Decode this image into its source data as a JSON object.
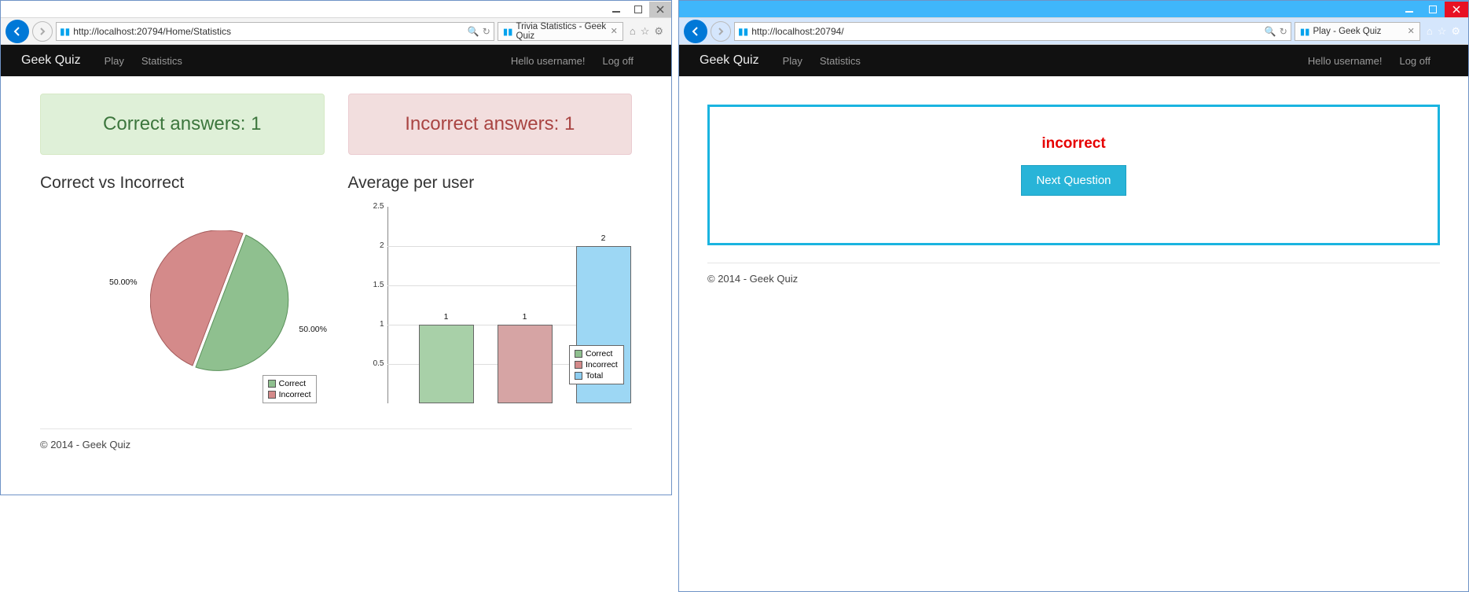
{
  "windows": {
    "left": {
      "address_url": "http://localhost:20794/Home/Statistics",
      "tab_title": "Trivia Statistics - Geek Quiz"
    },
    "right": {
      "address_url": "http://localhost:20794/",
      "tab_title": "Play - Geek Quiz"
    }
  },
  "navbar": {
    "brand": "Geek Quiz",
    "links": {
      "play": "Play",
      "statistics": "Statistics"
    },
    "greeting": "Hello username!",
    "logoff": "Log off"
  },
  "stats": {
    "correct_alert": "Correct answers: 1",
    "incorrect_alert": "Incorrect answers: 1",
    "pie_heading": "Correct vs Incorrect",
    "bar_heading": "Average per user",
    "legend": {
      "correct": "Correct",
      "incorrect": "Incorrect",
      "total": "Total"
    },
    "pie_labels": {
      "correct_pct": "50.00%",
      "incorrect_pct": "50.00%"
    }
  },
  "chart_data": [
    {
      "type": "pie",
      "title": "Correct vs Incorrect",
      "series": [
        {
          "name": "Correct",
          "value": 50.0
        },
        {
          "name": "Incorrect",
          "value": 50.0
        }
      ]
    },
    {
      "type": "bar",
      "title": "Average per user",
      "categories": [
        "Correct",
        "Incorrect",
        "Total"
      ],
      "values": [
        1,
        1,
        2
      ],
      "ylim": [
        0,
        2.5
      ],
      "yticks": [
        0.5,
        1.0,
        1.5,
        2.0,
        2.5
      ],
      "bar_labels": [
        "1",
        "1",
        "2"
      ]
    }
  ],
  "play": {
    "result_text": "incorrect",
    "next_button": "Next Question"
  },
  "footer": "© 2014 - Geek Quiz"
}
